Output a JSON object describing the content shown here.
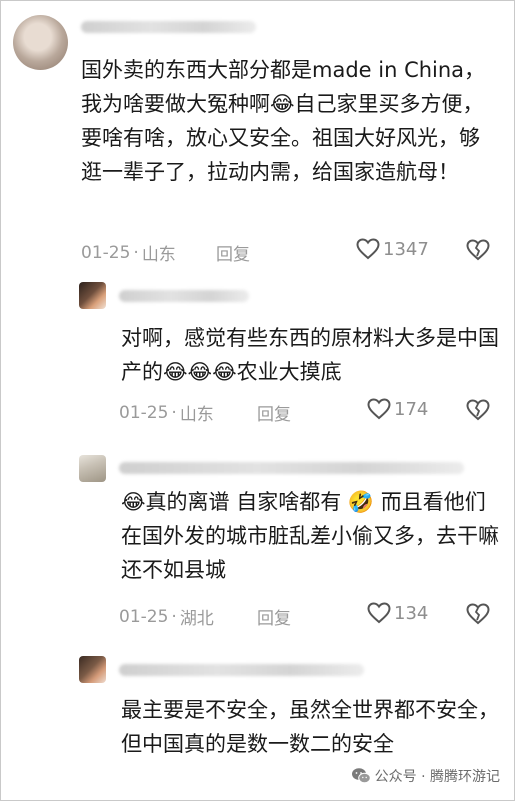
{
  "comments": [
    {
      "text": "国外卖的东西大部分都是made in China，我为啥要做大冤种啊😂自己家里买多方便，要啥有啥，放心又安全。祖国大好风光，够逛一辈子了，拉动内需，给国家造航母！",
      "date": "01-25",
      "location": "山东",
      "reply_label": "回复",
      "likes": "1347"
    },
    {
      "text": "对啊，感觉有些东西的原材料大多是中国产的😂😂😂农业大摸底",
      "date": "01-25",
      "location": "山东",
      "reply_label": "回复",
      "likes": "174"
    },
    {
      "text": "😂真的离谱  自家啥都有 🤣 而且看他们在国外发的城市脏乱差小偷又多，去干嘛  还不如县城",
      "date": "01-25",
      "location": "湖北",
      "reply_label": "回复",
      "likes": "134"
    },
    {
      "text": "最主要是不安全，虽然全世界都不安全，但中国真的是数一数二的安全"
    }
  ],
  "separator": "·",
  "watermark": {
    "icon": "wechat-icon",
    "text": "公众号 · 腾腾环游记"
  }
}
